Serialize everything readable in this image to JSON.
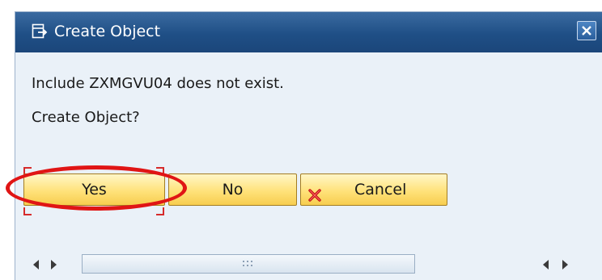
{
  "dialog": {
    "title": "Create Object",
    "title_icon": "create-object-icon",
    "close_icon": "close-icon"
  },
  "message": {
    "line1": "Include ZXMGVU04 does not exist.",
    "line2": "Create Object?"
  },
  "buttons": {
    "yes_label": "Yes",
    "no_label": "No",
    "cancel_label": "Cancel",
    "cancel_icon": "red-x-icon"
  },
  "annotation": {
    "highlight_color": "#e01515"
  },
  "colors": {
    "titlebar": "#1f4f86",
    "button_fill": "#ffe27a",
    "dialog_bg": "#eaf1f8"
  }
}
